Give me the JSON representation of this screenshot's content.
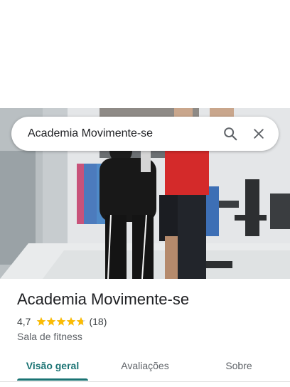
{
  "search": {
    "query": "Academia Movimente-se",
    "search_icon": "search-icon",
    "close_icon": "close-icon"
  },
  "place": {
    "name": "Academia Movimente-se",
    "rating": "4,7",
    "rating_value": 4.7,
    "review_count": "(18)",
    "category": "Sala de fitness"
  },
  "tabs": [
    {
      "label": "Visão geral",
      "active": true
    },
    {
      "label": "Avaliações",
      "active": false
    },
    {
      "label": "Sobre",
      "active": false
    }
  ],
  "colors": {
    "accent": "#1a7373",
    "star": "#fbbc04",
    "text_primary": "#202124",
    "text_secondary": "#5f6368"
  }
}
